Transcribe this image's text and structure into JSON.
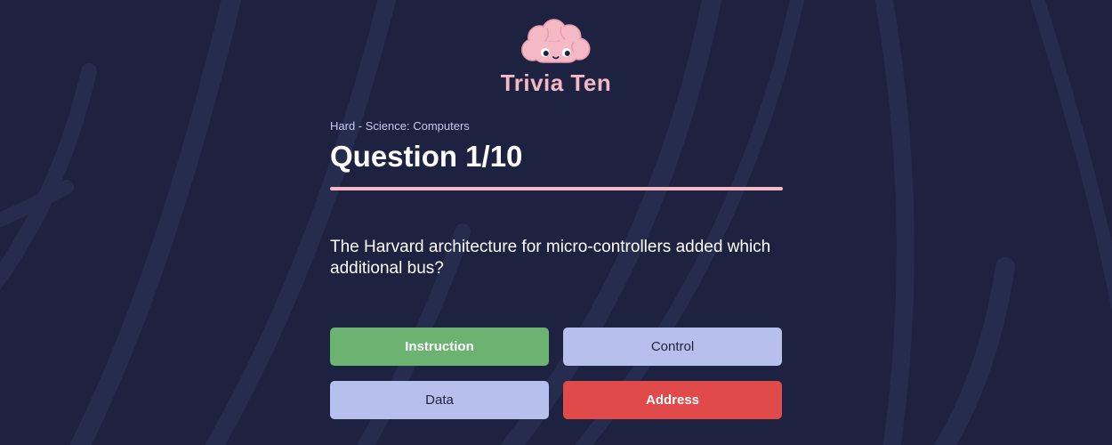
{
  "app": {
    "title": "Trivia Ten",
    "logo_icon": "brain-mascot-icon",
    "accent_color": "#f4b9c4",
    "background_color": "#1d2240"
  },
  "question": {
    "meta": "Hard - Science: Computers",
    "title": "Question 1/10",
    "text": "The Harvard architecture for micro-controllers added which additional bus?"
  },
  "answers": [
    {
      "label": "Instruction",
      "state": "correct",
      "color": "#6cb372"
    },
    {
      "label": "Control",
      "state": "neutral",
      "color": "#b7c0ec"
    },
    {
      "label": "Data",
      "state": "neutral",
      "color": "#b7c0ec"
    },
    {
      "label": "Address",
      "state": "wrong",
      "color": "#e04a4a"
    }
  ]
}
